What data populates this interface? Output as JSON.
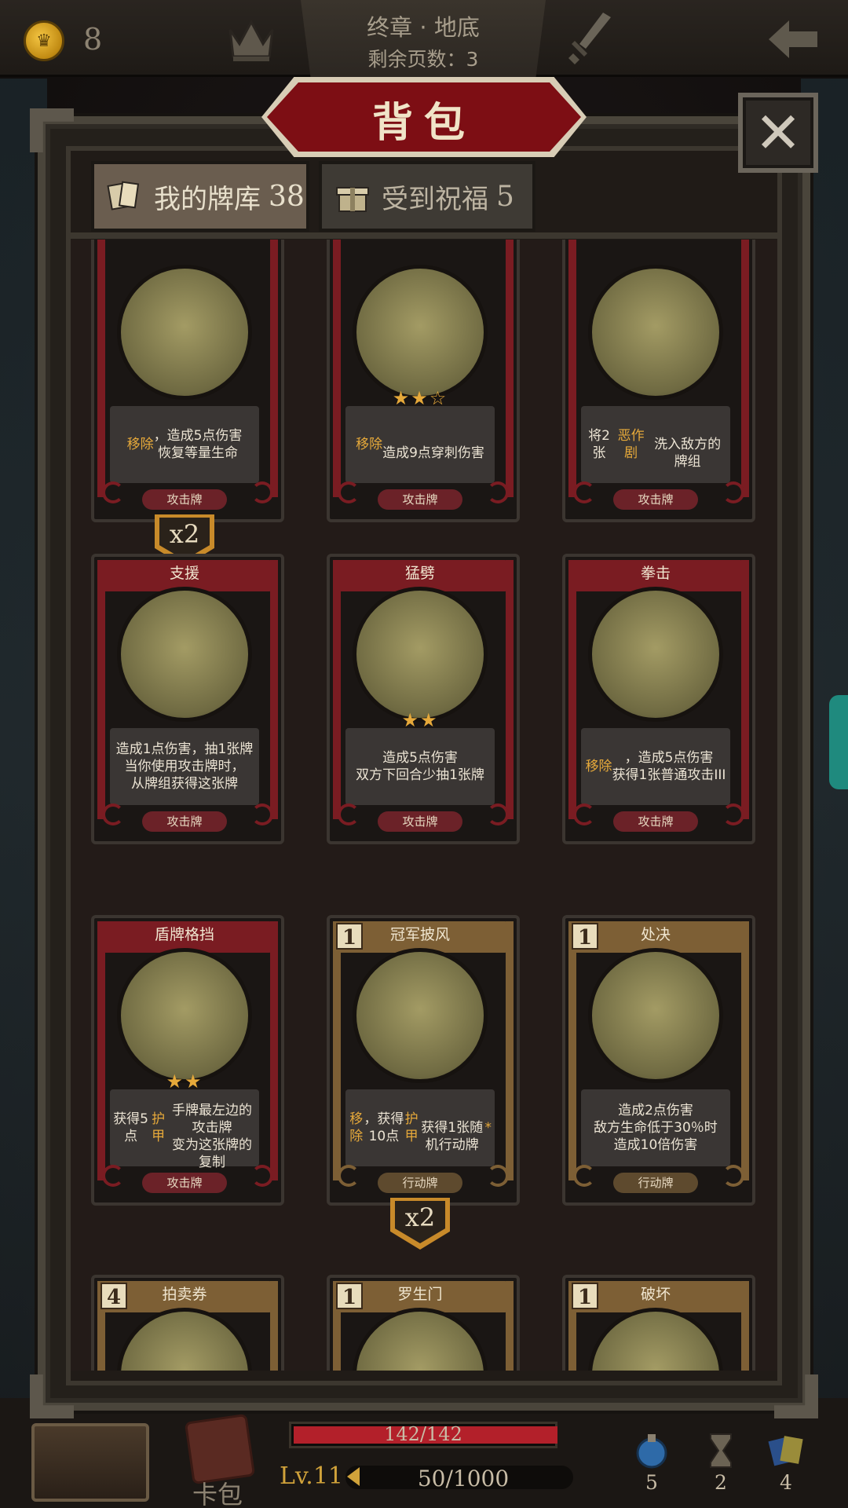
{
  "hud": {
    "coins": "8",
    "chapter": "终章 · 地底",
    "pages_left": "剩余页数：3",
    "icons": [
      "coin-icon",
      "crown-icon",
      "sword-icon",
      "back-arrow-icon"
    ]
  },
  "modal": {
    "title": "背包",
    "close_icon": "close-icon",
    "tabs": [
      {
        "label": "我的牌库",
        "count": "38",
        "icon": "cards-icon",
        "active": true
      },
      {
        "label": "受到祝福",
        "count": "5",
        "icon": "gift-icon",
        "active": false
      }
    ]
  },
  "cards": [
    {
      "name": "",
      "type": "攻击牌",
      "desc": "<span class='hl'>移除</span>，造成5点伤害<br>恢复等量生命",
      "stars": "",
      "cost": "",
      "art": "cleaver-icon",
      "kind": "attack",
      "copies": "x2"
    },
    {
      "name": "",
      "type": "攻击牌",
      "desc": "<span class='hl'>移除</span><br>造成9点穿刺伤害",
      "stars": "★★☆",
      "cost": "",
      "art": "dagger-icon",
      "kind": "attack",
      "copies": ""
    },
    {
      "name": "",
      "type": "攻击牌",
      "desc": "将2张<span class='hl'>恶作剧</span><br>洗入敌方的牌组",
      "stars": "",
      "cost": "",
      "art": "clown-icon",
      "kind": "attack",
      "copies": ""
    },
    {
      "name": "支援",
      "type": "攻击牌",
      "desc": "造成1点伤害，抽1张牌<br>当你使用攻击牌时，<br>从牌组获得这张牌",
      "stars": "",
      "cost": "",
      "art": "hooded-figure-icon",
      "kind": "attack",
      "copies": ""
    },
    {
      "name": "猛劈",
      "type": "攻击牌",
      "desc": "造成5点伤害<br>双方下回合少抽1张牌",
      "stars": "★★",
      "cost": "",
      "art": "axe-warrior-icon",
      "kind": "attack",
      "copies": ""
    },
    {
      "name": "拳击",
      "type": "攻击牌",
      "desc": "<span class='hl'>移除</span>，造成5点伤害<br>获得1张普通攻击III",
      "stars": "",
      "cost": "",
      "art": "skull-punch-icon",
      "kind": "attack",
      "copies": ""
    },
    {
      "name": "盾牌格挡",
      "type": "攻击牌",
      "desc": "获得5点<span class='hl'>护甲</span><br>手牌最左边的攻击牌<br>变为这张牌的复制",
      "stars": "★★",
      "cost": "",
      "art": "shield-knight-icon",
      "kind": "attack",
      "copies": ""
    },
    {
      "name": "冠军披风",
      "type": "行动牌",
      "desc": "<span class='hl'>移除</span>，获得10点<span class='hl'>护甲</span><br>获得1张随机行动牌<span class='hl'>*</span>",
      "stars": "",
      "cost": "1",
      "art": "cloak-icon",
      "kind": "action",
      "copies": "x2"
    },
    {
      "name": "处决",
      "type": "行动牌",
      "desc": "造成2点伤害<br>敌方生命低于30％时<br>造成10倍伤害",
      "stars": "",
      "cost": "1",
      "art": "execution-icon",
      "kind": "action",
      "copies": ""
    },
    {
      "name": "拍卖券",
      "type": "",
      "desc": "",
      "stars": "",
      "cost": "4",
      "art": "hammer-icon",
      "kind": "action",
      "copies": ""
    },
    {
      "name": "罗生门",
      "type": "",
      "desc": "",
      "stars": "",
      "cost": "1",
      "art": "demon-icon",
      "kind": "action",
      "copies": ""
    },
    {
      "name": "破坏",
      "type": "",
      "desc": "",
      "stars": "",
      "cost": "1",
      "art": "explosion-icon",
      "kind": "action",
      "copies": ""
    }
  ],
  "bottom": {
    "card_pack_label": "卡包",
    "hp": "142/142",
    "hp_fraction": 1.0,
    "level": "Lv.11",
    "xp": "50/1000",
    "resources": [
      {
        "icon": "potion-icon",
        "count": "5"
      },
      {
        "icon": "hourglass-icon",
        "count": "2"
      },
      {
        "icon": "cards-stack-icon",
        "count": "4"
      }
    ]
  },
  "colors": {
    "attack_frame": "#7a1c22",
    "action_frame": "#7d5f35",
    "banner": "#7d0e14",
    "highlight": "#e6a93a",
    "hp_bar": "#b3202a"
  }
}
